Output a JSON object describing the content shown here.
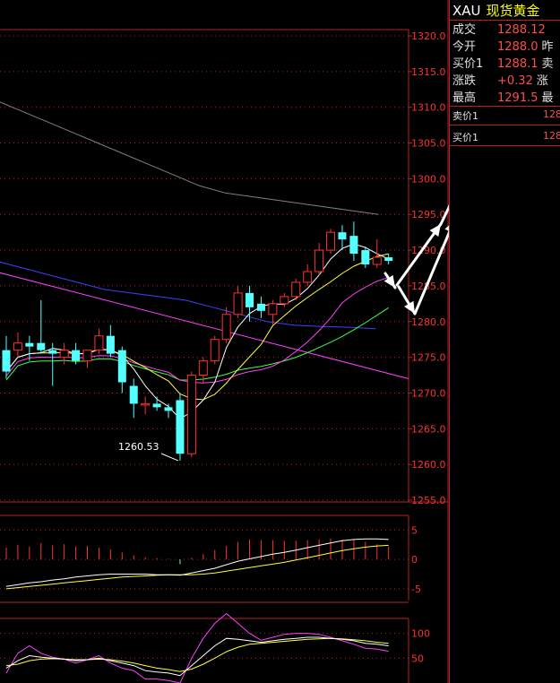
{
  "quote": {
    "symbol": "XAU",
    "name": "现货黄金",
    "rows": [
      {
        "k": "成交",
        "v": "1288.12",
        "k2": ""
      },
      {
        "k": "今开",
        "v": "1288.0",
        "k2": "昨"
      },
      {
        "k": "买价1",
        "v": "1288.1",
        "k2": "卖"
      },
      {
        "k": "涨跌",
        "v": "+0.32",
        "k2": "涨"
      },
      {
        "k": "最高",
        "v": "1291.5",
        "k2": "最"
      }
    ],
    "orderbook": [
      {
        "k": "卖价1",
        "v": "128"
      },
      {
        "k": "买价1",
        "v": "128"
      }
    ]
  },
  "colors": {
    "bg": "#000000",
    "frame": "#b22222",
    "up": "#ff3030",
    "down": "#54ffff",
    "ma_white": "#ffffff",
    "ma_yellow": "#ffff40",
    "ma_magenta": "#ff40ff",
    "ma_green": "#40ff40",
    "ma_blue": "#4040ff",
    "ma_gray": "#808080",
    "trend_line": "#ff40ff",
    "arrows": "#ffffff"
  },
  "chart_data": [
    {
      "type": "candlestick",
      "yticks": [
        "1320.0",
        "1315.0",
        "1310.0",
        "1305.0",
        "1300.0",
        "1295.0",
        "1290.0",
        "1285.0",
        "1280.0",
        "1275.0",
        "1270.0",
        "1265.0",
        "1260.0",
        "1255.0"
      ],
      "ylim": [
        1255,
        1320
      ],
      "annotation": "1260.53",
      "candles": [
        {
          "o": 1276,
          "h": 1278,
          "l": 1272,
          "c": 1273
        },
        {
          "o": 1276,
          "h": 1278.5,
          "l": 1275,
          "c": 1277
        },
        {
          "o": 1277,
          "h": 1278,
          "l": 1274.5,
          "c": 1276.5
        },
        {
          "o": 1277,
          "h": 1283,
          "l": 1275.5,
          "c": 1276
        },
        {
          "o": 1276,
          "h": 1277,
          "l": 1271,
          "c": 1275.5
        },
        {
          "o": 1275,
          "h": 1277,
          "l": 1274,
          "c": 1276
        },
        {
          "o": 1276,
          "h": 1277,
          "l": 1274,
          "c": 1274.5
        },
        {
          "o": 1274.5,
          "h": 1276,
          "l": 1273.5,
          "c": 1276
        },
        {
          "o": 1276,
          "h": 1279,
          "l": 1275.5,
          "c": 1278
        },
        {
          "o": 1278,
          "h": 1279.5,
          "l": 1275,
          "c": 1275.5
        },
        {
          "o": 1276,
          "h": 1276.5,
          "l": 1270,
          "c": 1271.5
        },
        {
          "o": 1271,
          "h": 1272,
          "l": 1266.5,
          "c": 1268.5
        },
        {
          "o": 1268.5,
          "h": 1269.5,
          "l": 1267,
          "c": 1268.5
        },
        {
          "o": 1268.5,
          "h": 1269.5,
          "l": 1267.5,
          "c": 1268
        },
        {
          "o": 1268,
          "h": 1268.5,
          "l": 1266.5,
          "c": 1267.5
        },
        {
          "o": 1269,
          "h": 1270,
          "l": 1260.53,
          "c": 1261.5
        },
        {
          "o": 1261.5,
          "h": 1273,
          "l": 1261,
          "c": 1272.5
        },
        {
          "o": 1272.5,
          "h": 1275,
          "l": 1271.5,
          "c": 1274.5
        },
        {
          "o": 1274.5,
          "h": 1278,
          "l": 1274,
          "c": 1277.5
        },
        {
          "o": 1277.5,
          "h": 1282,
          "l": 1277,
          "c": 1281
        },
        {
          "o": 1281,
          "h": 1285,
          "l": 1280.5,
          "c": 1284
        },
        {
          "o": 1284,
          "h": 1285,
          "l": 1280,
          "c": 1282
        },
        {
          "o": 1282.5,
          "h": 1283.5,
          "l": 1280.5,
          "c": 1281.5
        },
        {
          "o": 1281,
          "h": 1283,
          "l": 1279.5,
          "c": 1282.5
        },
        {
          "o": 1282.5,
          "h": 1284,
          "l": 1282,
          "c": 1283.5
        },
        {
          "o": 1283.5,
          "h": 1286,
          "l": 1283,
          "c": 1285.5
        },
        {
          "o": 1285.5,
          "h": 1288,
          "l": 1285,
          "c": 1287
        },
        {
          "o": 1287,
          "h": 1291,
          "l": 1286.5,
          "c": 1290
        },
        {
          "o": 1290,
          "h": 1293,
          "l": 1289.5,
          "c": 1292.5
        },
        {
          "o": 1292.5,
          "h": 1293.5,
          "l": 1290,
          "c": 1291.5
        },
        {
          "o": 1292,
          "h": 1294,
          "l": 1288.5,
          "c": 1289.5
        },
        {
          "o": 1290,
          "h": 1290.5,
          "l": 1287.5,
          "c": 1288
        },
        {
          "o": 1288,
          "h": 1291.5,
          "l": 1287.5,
          "c": 1289
        },
        {
          "o": 1289,
          "h": 1289.5,
          "l": 1288,
          "c": 1288.5
        }
      ]
    },
    {
      "type": "macd",
      "yticks": [
        "5",
        "0",
        "-5"
      ],
      "ylim": [
        -7,
        7.5
      ],
      "hist": [
        2.0,
        2.5,
        2.2,
        2.8,
        2.4,
        2.6,
        2.2,
        2.3,
        2.0,
        1.7,
        1.2,
        0.7,
        0.4,
        0.2,
        0.1,
        -0.8,
        0.3,
        0.9,
        1.6,
        2.3,
        3.0,
        3.4,
        3.3,
        3.3,
        3.2,
        3.2,
        3.3,
        3.4,
        3.5,
        3.4,
        3.3,
        3.0,
        2.6,
        2.2
      ],
      "dif": [
        -4.6,
        -4.3,
        -4.0,
        -3.8,
        -3.5,
        -3.3,
        -3.0,
        -2.8,
        -2.6,
        -2.5,
        -2.5,
        -2.5,
        -2.5,
        -2.6,
        -2.6,
        -2.7,
        -2.3,
        -1.9,
        -1.5,
        -0.9,
        -0.3,
        0.1,
        0.5,
        0.9,
        1.2,
        1.6,
        2.0,
        2.4,
        2.8,
        3.2,
        3.4,
        3.5,
        3.5,
        3.4
      ],
      "dea": [
        -5.0,
        -4.8,
        -4.6,
        -4.4,
        -4.2,
        -4.0,
        -3.8,
        -3.6,
        -3.4,
        -3.2,
        -3.0,
        -2.9,
        -2.8,
        -2.7,
        -2.6,
        -2.6,
        -2.6,
        -2.5,
        -2.3,
        -2.0,
        -1.7,
        -1.4,
        -1.1,
        -0.8,
        -0.5,
        -0.1,
        0.3,
        0.7,
        1.1,
        1.5,
        1.8,
        2.1,
        2.3,
        2.4
      ]
    },
    {
      "type": "kdj",
      "yticks": [
        "100",
        "50"
      ],
      "ylim": [
        0,
        130
      ],
      "k": [
        30,
        45,
        55,
        52,
        50,
        48,
        45,
        47,
        50,
        45,
        40,
        35,
        25,
        22,
        20,
        15,
        35,
        55,
        75,
        90,
        88,
        85,
        82,
        85,
        88,
        90,
        92,
        92,
        90,
        88,
        85,
        80,
        78,
        75
      ],
      "d": [
        35,
        38,
        45,
        48,
        49,
        48,
        47,
        47,
        48,
        47,
        44,
        40,
        35,
        30,
        27,
        23,
        28,
        38,
        50,
        63,
        72,
        78,
        80,
        82,
        84,
        86,
        88,
        89,
        90,
        89,
        87,
        85,
        82,
        80
      ],
      "j": [
        20,
        60,
        75,
        60,
        52,
        48,
        40,
        47,
        55,
        40,
        30,
        25,
        8,
        8,
        5,
        0,
        50,
        90,
        120,
        140,
        120,
        100,
        86,
        92,
        98,
        100,
        100,
        98,
        92,
        85,
        78,
        70,
        68,
        64
      ]
    }
  ]
}
